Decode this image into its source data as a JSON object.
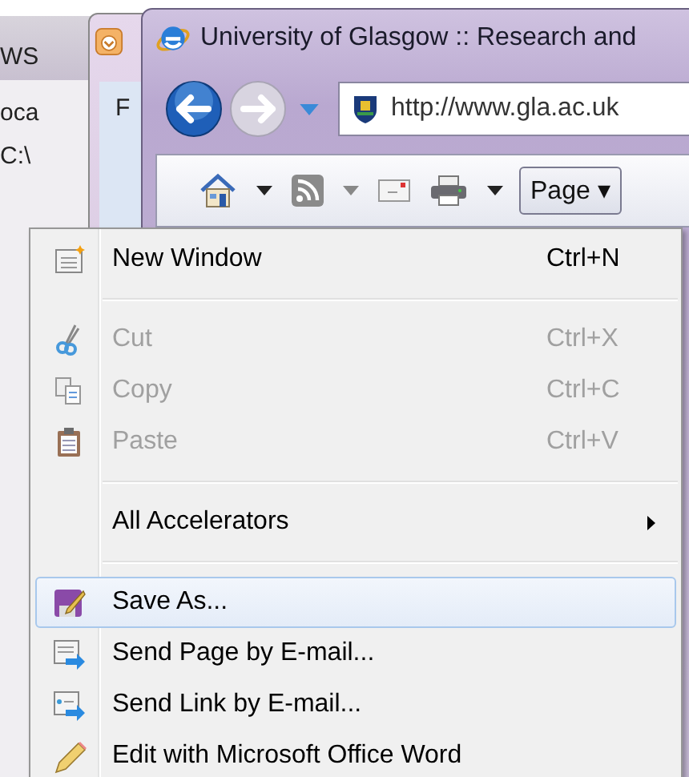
{
  "background_windows": [
    {
      "texts": [
        "WS",
        "oca",
        "C:\\"
      ]
    },
    {
      "texts": [
        "F"
      ]
    }
  ],
  "browser": {
    "title": "University of Glasgow :: Research and",
    "address": "http://www.gla.ac.uk",
    "page_button": "Page ▾"
  },
  "menu": [
    {
      "kind": "item",
      "label": "New Window",
      "shortcut": "Ctrl+N",
      "disabled": false,
      "selected": false
    },
    {
      "kind": "separator"
    },
    {
      "kind": "item",
      "label": "Cut",
      "shortcut": "Ctrl+X",
      "disabled": true,
      "selected": false
    },
    {
      "kind": "item",
      "label": "Copy",
      "shortcut": "Ctrl+C",
      "disabled": true,
      "selected": false
    },
    {
      "kind": "item",
      "label": "Paste",
      "shortcut": "Ctrl+V",
      "disabled": true,
      "selected": false
    },
    {
      "kind": "separator"
    },
    {
      "kind": "submenu",
      "label": "All Accelerators",
      "disabled": false,
      "selected": false
    },
    {
      "kind": "separator"
    },
    {
      "kind": "item",
      "label": "Save As...",
      "disabled": false,
      "selected": true
    },
    {
      "kind": "item",
      "label": "Send Page by E-mail...",
      "disabled": false,
      "selected": false
    },
    {
      "kind": "item",
      "label": "Send Link by E-mail...",
      "disabled": false,
      "selected": false
    },
    {
      "kind": "item",
      "label": "Edit with Microsoft Office Word",
      "disabled": false,
      "selected": false
    }
  ]
}
